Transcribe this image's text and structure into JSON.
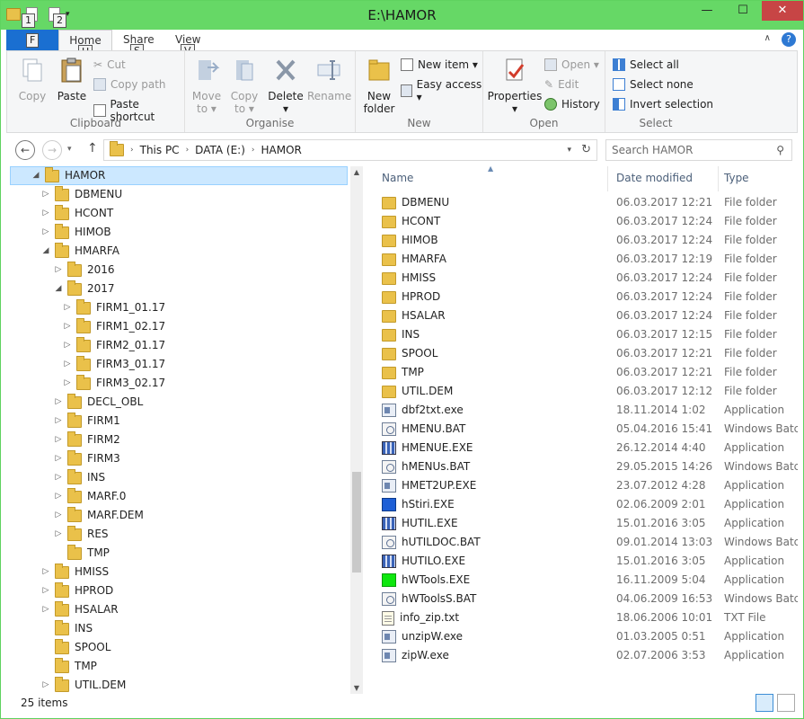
{
  "window": {
    "title": "E:\\HAMOR",
    "minimize": "—",
    "maximize": "☐",
    "close": "✕"
  },
  "qat": {
    "keytip1": "1",
    "keytip2": "2"
  },
  "ribbon_tabs": {
    "file": "F",
    "home": "Home",
    "share": "Share",
    "view": "View",
    "keytip_home": "H",
    "keytip_share": "S",
    "keytip_view": "V"
  },
  "clipboard": {
    "label": "Clipboard",
    "copy": "Copy",
    "paste": "Paste",
    "cut": "Cut",
    "copy_path": "Copy path",
    "paste_shortcut": "Paste shortcut"
  },
  "organise": {
    "label": "Organise",
    "move_to": "Move",
    "move_to_2": "to ▾",
    "copy_to": "Copy",
    "copy_to_2": "to ▾",
    "delete": "Delete",
    "delete_2": "▾",
    "rename": "Rename"
  },
  "new": {
    "label": "New",
    "new_folder": "New",
    "new_folder_2": "folder",
    "new_item": "New item ▾",
    "easy_access": "Easy access ▾"
  },
  "open": {
    "label": "Open",
    "properties": "Properties",
    "properties_2": "▾",
    "open": "Open ▾",
    "edit": "Edit",
    "history": "History"
  },
  "select": {
    "label": "Select",
    "select_all": "Select all",
    "select_none": "Select none",
    "invert": "Invert selection"
  },
  "nav": {
    "back": "←",
    "forward": "→",
    "up": "↑",
    "breadcrumbs": [
      "This PC",
      "DATA (E:)",
      "HAMOR"
    ],
    "search_placeholder": "Search HAMOR"
  },
  "tree": [
    {
      "label": "HAMOR",
      "level": 0,
      "arrow": "◢",
      "selected": true
    },
    {
      "label": "DBMENU",
      "level": 1,
      "arrow": "▷"
    },
    {
      "label": "HCONT",
      "level": 1,
      "arrow": "▷"
    },
    {
      "label": "HIMOB",
      "level": 1,
      "arrow": "▷"
    },
    {
      "label": "HMARFA",
      "level": 1,
      "arrow": "◢"
    },
    {
      "label": "2016",
      "level": 2,
      "arrow": "▷"
    },
    {
      "label": "2017",
      "level": 2,
      "arrow": "◢"
    },
    {
      "label": "FIRM1_01.17",
      "level": 3,
      "arrow": "▷"
    },
    {
      "label": "FIRM1_02.17",
      "level": 3,
      "arrow": "▷"
    },
    {
      "label": "FIRM2_01.17",
      "level": 3,
      "arrow": "▷"
    },
    {
      "label": "FIRM3_01.17",
      "level": 3,
      "arrow": "▷"
    },
    {
      "label": "FIRM3_02.17",
      "level": 3,
      "arrow": "▷"
    },
    {
      "label": "DECL_OBL",
      "level": 2,
      "arrow": "▷"
    },
    {
      "label": "FIRM1",
      "level": 2,
      "arrow": "▷"
    },
    {
      "label": "FIRM2",
      "level": 2,
      "arrow": "▷"
    },
    {
      "label": "FIRM3",
      "level": 2,
      "arrow": "▷"
    },
    {
      "label": "INS",
      "level": 2,
      "arrow": "▷"
    },
    {
      "label": "MARF.0",
      "level": 2,
      "arrow": "▷"
    },
    {
      "label": "MARF.DEM",
      "level": 2,
      "arrow": "▷"
    },
    {
      "label": "RES",
      "level": 2,
      "arrow": "▷"
    },
    {
      "label": "TMP",
      "level": 2,
      "arrow": ""
    },
    {
      "label": "HMISS",
      "level": 1,
      "arrow": "▷"
    },
    {
      "label": "HPROD",
      "level": 1,
      "arrow": "▷"
    },
    {
      "label": "HSALAR",
      "level": 1,
      "arrow": "▷"
    },
    {
      "label": "INS",
      "level": 1,
      "arrow": ""
    },
    {
      "label": "SPOOL",
      "level": 1,
      "arrow": ""
    },
    {
      "label": "TMP",
      "level": 1,
      "arrow": ""
    },
    {
      "label": "UTIL.DEM",
      "level": 1,
      "arrow": "▷"
    }
  ],
  "columns": {
    "name": "Name",
    "date": "Date modified",
    "type": "Type"
  },
  "files": [
    {
      "name": "DBMENU",
      "date": "06.03.2017 12:21",
      "type": "File folder",
      "icon": "folder"
    },
    {
      "name": "HCONT",
      "date": "06.03.2017 12:24",
      "type": "File folder",
      "icon": "folder"
    },
    {
      "name": "HIMOB",
      "date": "06.03.2017 12:24",
      "type": "File folder",
      "icon": "folder"
    },
    {
      "name": "HMARFA",
      "date": "06.03.2017 12:19",
      "type": "File folder",
      "icon": "folder"
    },
    {
      "name": "HMISS",
      "date": "06.03.2017 12:24",
      "type": "File folder",
      "icon": "folder"
    },
    {
      "name": "HPROD",
      "date": "06.03.2017 12:24",
      "type": "File folder",
      "icon": "folder"
    },
    {
      "name": "HSALAR",
      "date": "06.03.2017 12:24",
      "type": "File folder",
      "icon": "folder"
    },
    {
      "name": "INS",
      "date": "06.03.2017 12:15",
      "type": "File folder",
      "icon": "folder"
    },
    {
      "name": "SPOOL",
      "date": "06.03.2017 12:21",
      "type": "File folder",
      "icon": "folder"
    },
    {
      "name": "TMP",
      "date": "06.03.2017 12:21",
      "type": "File folder",
      "icon": "folder"
    },
    {
      "name": "UTIL.DEM",
      "date": "06.03.2017 12:12",
      "type": "File folder",
      "icon": "folder"
    },
    {
      "name": "dbf2txt.exe",
      "date": "18.11.2014 1:02",
      "type": "Application",
      "icon": "app"
    },
    {
      "name": "HMENU.BAT",
      "date": "05.04.2016 15:41",
      "type": "Windows Batch File",
      "icon": "bat"
    },
    {
      "name": "HMENUE.EXE",
      "date": "26.12.2014 4:40",
      "type": "Application",
      "icon": "grid"
    },
    {
      "name": "hMENUs.BAT",
      "date": "29.05.2015 14:26",
      "type": "Windows Batch File",
      "icon": "bat"
    },
    {
      "name": "HMET2UP.EXE",
      "date": "23.07.2012 4:28",
      "type": "Application",
      "icon": "app"
    },
    {
      "name": "hStiri.EXE",
      "date": "02.06.2009 2:01",
      "type": "Application",
      "icon": "blue"
    },
    {
      "name": "HUTIL.EXE",
      "date": "15.01.2016 3:05",
      "type": "Application",
      "icon": "grid"
    },
    {
      "name": "hUTILDOC.BAT",
      "date": "09.01.2014 13:03",
      "type": "Windows Batch File",
      "icon": "bat"
    },
    {
      "name": "HUTILO.EXE",
      "date": "15.01.2016 3:05",
      "type": "Application",
      "icon": "grid"
    },
    {
      "name": "hWTools.EXE",
      "date": "16.11.2009 5:04",
      "type": "Application",
      "icon": "green"
    },
    {
      "name": "hWToolsS.BAT",
      "date": "04.06.2009 16:53",
      "type": "Windows Batch File",
      "icon": "bat"
    },
    {
      "name": "info_zip.txt",
      "date": "18.06.2006 10:01",
      "type": "TXT File",
      "icon": "txt"
    },
    {
      "name": "unzipW.exe",
      "date": "01.03.2005 0:51",
      "type": "Application",
      "icon": "app"
    },
    {
      "name": "zipW.exe",
      "date": "02.07.2006 3:53",
      "type": "Application",
      "icon": "app"
    }
  ],
  "status": {
    "count": "25 items"
  },
  "colors": {
    "title_bar": "#66d866",
    "file_tab": "#1a6fd1",
    "selection": "#cce8ff"
  }
}
